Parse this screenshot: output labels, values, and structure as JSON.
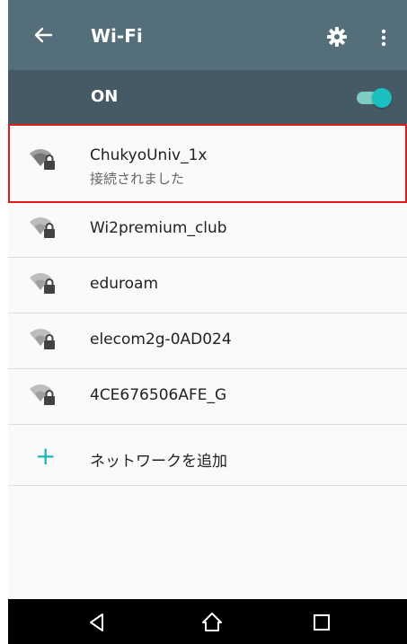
{
  "toolbar": {
    "title": "Wi-Fi",
    "back_icon": "arrow-left-icon",
    "settings_icon": "gear-icon",
    "more_icon": "more-vertical-icon",
    "background": "#546e7a"
  },
  "wifi_toggle": {
    "label": "ON",
    "state": "on",
    "accent": "#1bbfbf",
    "background": "#455a64"
  },
  "networks": [
    {
      "name": "ChukyoUniv_1x",
      "status": "接続されました",
      "icon": "wifi-secured-icon",
      "highlighted": true
    },
    {
      "name": "Wi2premium_club",
      "icon": "wifi-secured-icon"
    },
    {
      "name": "eduroam",
      "icon": "wifi-secured-icon"
    },
    {
      "name": "elecom2g-0AD024",
      "icon": "wifi-secured-icon"
    },
    {
      "name": "4CE676506AFE_G",
      "icon": "wifi-secured-icon"
    }
  ],
  "add_network": {
    "label": "ネットワークを追加",
    "icon": "plus-icon",
    "accent": "#1bb6b6"
  },
  "highlight_color": "#e01b1b",
  "nav_bar": {
    "back_icon": "nav-back-icon",
    "home_icon": "nav-home-icon",
    "recent_icon": "nav-recent-apps-icon"
  }
}
